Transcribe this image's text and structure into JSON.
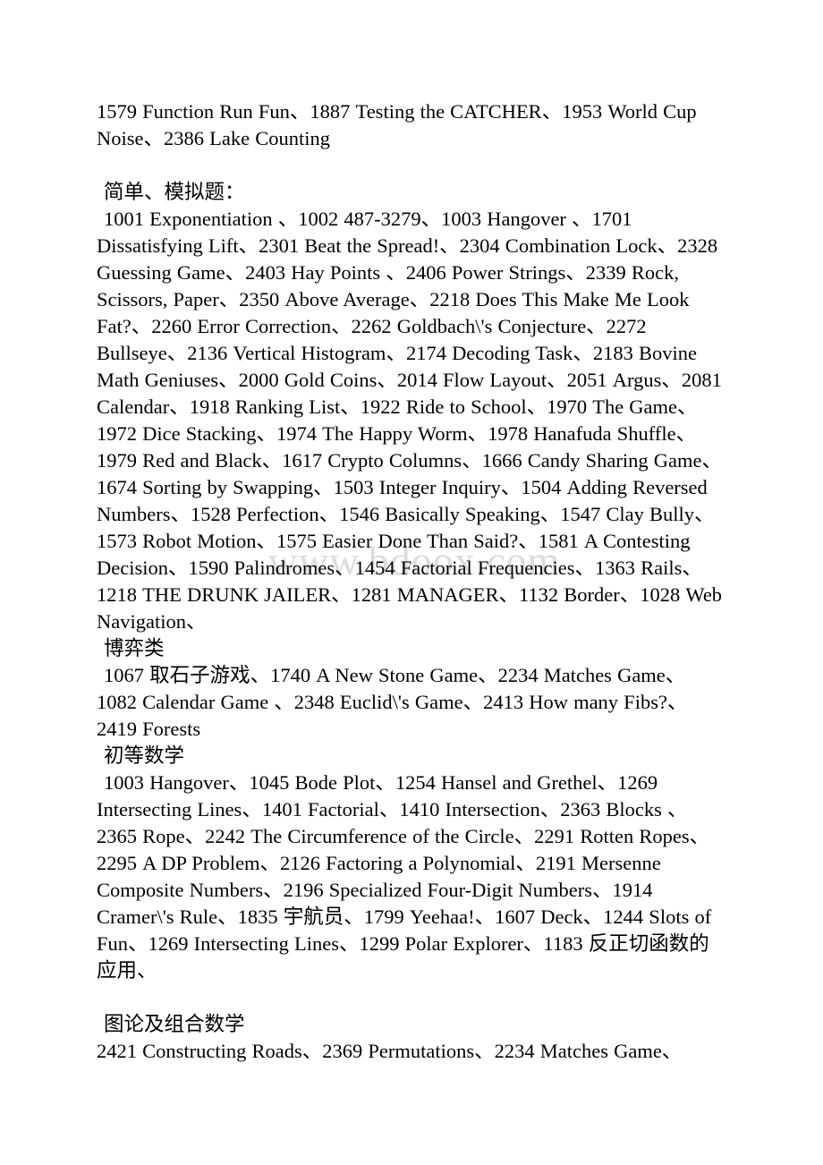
{
  "document": {
    "watermark": "www.bdoox.com",
    "blocks": [
      {
        "id": "intro-list",
        "type": "paragraph",
        "text": "1579 Function Run Fun、1887 Testing the CATCHER、1953 World Cup Noise、2386 Lake Counting"
      },
      {
        "id": "heading-simple",
        "type": "heading",
        "text": "简单、模拟题："
      },
      {
        "id": "list-simple",
        "type": "paragraph",
        "text": "1001 Exponentiation 、1002 487-3279、1003 Hangover 、1701 Dissatisfying Lift、2301 Beat the Spread!、2304 Combination Lock、2328 Guessing Game、2403 Hay Points 、2406 Power Strings、2339 Rock, Scissors, Paper、2350 Above Average、2218 Does This Make Me Look Fat?、2260 Error Correction、2262 Goldbach\\'s Conjecture、2272 Bullseye、2136 Vertical Histogram、2174 Decoding Task、2183 Bovine Math Geniuses、2000 Gold Coins、2014 Flow Layout、2051 Argus、2081 Calendar、1918 Ranking List、1922 Ride to School、1970 The Game、1972 Dice Stacking、1974 The Happy Worm、1978 Hanafuda Shuffle、1979 Red and Black、1617 Crypto Columns、1666 Candy Sharing Game、1674 Sorting by Swapping、1503 Integer Inquiry、1504 Adding Reversed Numbers、1528 Perfection、1546 Basically Speaking、1547 Clay Bully、1573 Robot Motion、1575 Easier Done Than Said?、1581 A Contesting Decision、1590 Palindromes、1454 Factorial Frequencies、1363 Rails、1218 THE DRUNK JAILER、1281 MANAGER、1132 Border、1028 Web Navigation、"
      },
      {
        "id": "heading-game",
        "type": "heading",
        "text": "博弈类"
      },
      {
        "id": "list-game",
        "type": "paragraph",
        "text": "1067 取石子游戏、1740 A New Stone Game、2234 Matches Game、1082 Calendar Game 、2348 Euclid\\'s Game、2413 How many Fibs?、2419 Forests"
      },
      {
        "id": "heading-elementary-math",
        "type": "heading",
        "text": "初等数学"
      },
      {
        "id": "list-elementary-math",
        "type": "paragraph",
        "text": "1003 Hangover、1045 Bode Plot、1254 Hansel and Grethel、1269 Intersecting Lines、1401 Factorial、1410 Intersection、2363 Blocks 、2365 Rope、2242 The Circumference of the Circle、2291 Rotten Ropes、2295 A DP Problem、2126 Factoring a Polynomial、2191 Mersenne Composite Numbers、2196 Specialized Four-Digit Numbers、1914 Cramer\\'s Rule、1835 宇航员、1799 Yeehaa!、1607 Deck、1244 Slots of Fun、1269 Intersecting Lines、1299 Polar Explorer、1183 反正切函数的应用、"
      },
      {
        "id": "heading-graph-combinatorics",
        "type": "heading",
        "text": "图论及组合数学"
      },
      {
        "id": "list-graph-combinatorics",
        "type": "paragraph",
        "text": "2421 Constructing Roads、2369 Permutations、2234 Matches Game、"
      }
    ]
  }
}
